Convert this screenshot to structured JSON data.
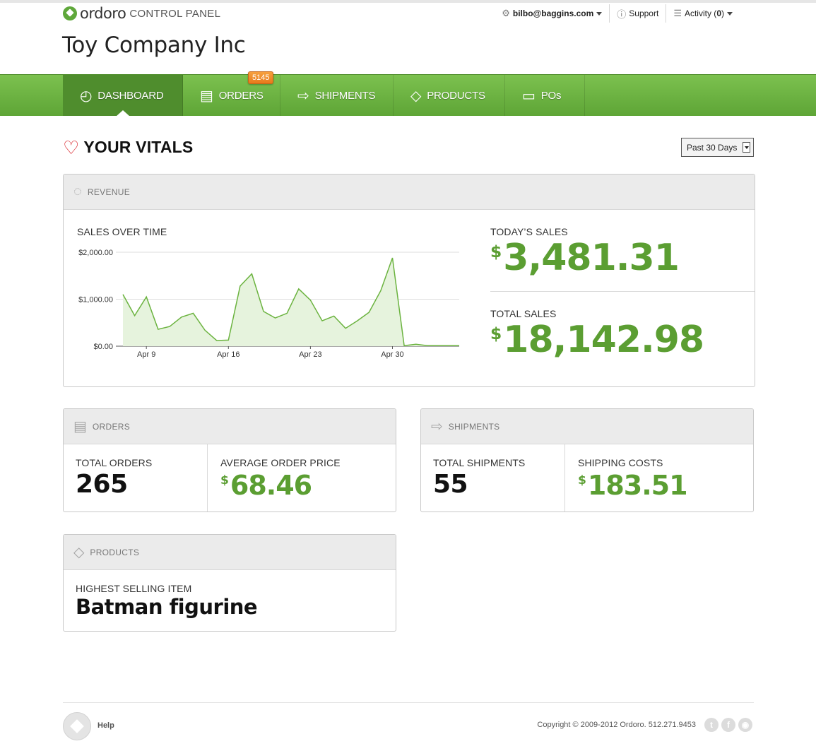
{
  "header": {
    "logo_word": "ordoro",
    "logo_sub": "CONTROL PANEL",
    "account_email": "bilbo@baggins.com",
    "support": "Support",
    "activity_label": "Activity (",
    "activity_count": "0",
    "activity_close": ")",
    "company": "Toy Company Inc"
  },
  "nav": {
    "items": [
      {
        "label": "DASHBOARD",
        "icon": "dashboard-icon"
      },
      {
        "label": "ORDERS",
        "icon": "orders-icon"
      },
      {
        "label": "SHIPMENTS",
        "icon": "shipments-icon"
      },
      {
        "label": "PRODUCTS",
        "icon": "tag-icon"
      },
      {
        "label": "POs",
        "icon": "card-icon"
      }
    ],
    "orders_badge": "5145"
  },
  "vitals": {
    "title": "YOUR VITALS",
    "range": "Past 30 Days"
  },
  "revenue": {
    "header": "REVENUE",
    "chart_title": "SALES OVER TIME",
    "today_label": "TODAY’S SALES",
    "today_value": "3,481.31",
    "total_label": "TOTAL SALES",
    "total_value": "18,142.98",
    "currency": "$"
  },
  "orders": {
    "header": "ORDERS",
    "total_label": "TOTAL ORDERS",
    "total_value": "265",
    "avg_label": "AVERAGE ORDER PRICE",
    "avg_value": "68.46"
  },
  "shipments": {
    "header": "SHIPMENTS",
    "total_label": "TOTAL SHIPMENTS",
    "total_value": "55",
    "cost_label": "SHIPPING COSTS",
    "cost_value": "183.51"
  },
  "products": {
    "header": "PRODUCTS",
    "highest_label": "HIGHEST SELLING ITEM",
    "highest_value": "Batman figurine"
  },
  "footer": {
    "help": "Help",
    "copyright": "Copyright © 2009-2012 Ordoro. 512.271.9453",
    "social": [
      "twitter-icon",
      "facebook-icon",
      "rss-icon"
    ]
  },
  "colors": {
    "brand_green": "#5fa83b",
    "value_green": "#5b9e32",
    "badge_orange": "#f08c2c",
    "heart_red": "#d9262c"
  },
  "chart_data": {
    "type": "area",
    "title": "SALES OVER TIME",
    "xlabel": "",
    "ylabel": "",
    "y_ticks": [
      "$0.00",
      "$1,000.00",
      "$2,000.00"
    ],
    "x_ticks": [
      {
        "label": "Apr 9",
        "day": 9
      },
      {
        "label": "Apr 16",
        "day": 16
      },
      {
        "label": "Apr 23",
        "day": 23
      },
      {
        "label": "Apr 30",
        "day": 30
      }
    ],
    "ylim": [
      0,
      2000
    ],
    "grid": true,
    "x": [
      7,
      8,
      9,
      10,
      11,
      12,
      13,
      14,
      15,
      16,
      17,
      18,
      19,
      20,
      21,
      22,
      23,
      24,
      25,
      26,
      27,
      28,
      29,
      30,
      31,
      32,
      33,
      34,
      35,
      36
    ],
    "values": [
      1100,
      650,
      1050,
      360,
      420,
      620,
      700,
      340,
      120,
      130,
      1280,
      1540,
      740,
      600,
      700,
      1220,
      980,
      540,
      640,
      380,
      540,
      720,
      1180,
      1880,
      10,
      40,
      10,
      10,
      10,
      10
    ]
  }
}
